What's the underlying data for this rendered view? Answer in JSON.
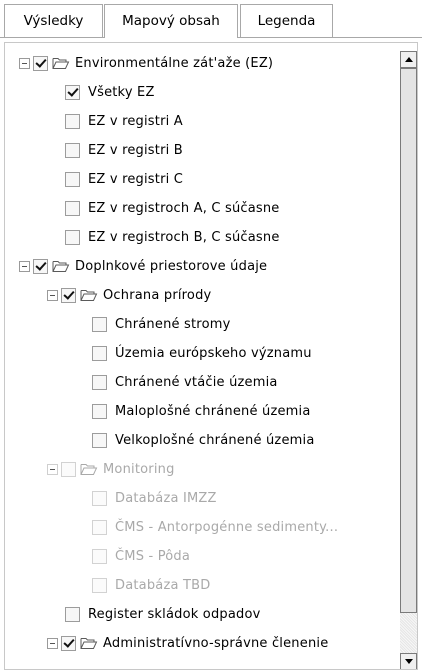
{
  "tabs": [
    {
      "label": "Výsledky",
      "active": false
    },
    {
      "label": "Mapový obsah",
      "active": true
    },
    {
      "label": "Legenda",
      "active": false
    }
  ],
  "tree": {
    "items": [
      {
        "label": "Environmentálne zát'aže (EZ)",
        "checked": true,
        "folder": true,
        "expander": true,
        "dim": false
      },
      {
        "label": "Všetky EZ",
        "checked": true,
        "folder": false,
        "expander": false,
        "dim": false
      },
      {
        "label": "EZ v registri A",
        "checked": false,
        "folder": false,
        "expander": false,
        "dim": false
      },
      {
        "label": "EZ v registri B",
        "checked": false,
        "folder": false,
        "expander": false,
        "dim": false
      },
      {
        "label": "EZ v registri C",
        "checked": false,
        "folder": false,
        "expander": false,
        "dim": false
      },
      {
        "label": "EZ v registroch A, C súčasne",
        "checked": false,
        "folder": false,
        "expander": false,
        "dim": false
      },
      {
        "label": "EZ v registroch B, C súčasne",
        "checked": false,
        "folder": false,
        "expander": false,
        "dim": false
      },
      {
        "label": "Doplnkové priestorove údaje",
        "checked": true,
        "folder": true,
        "expander": true,
        "dim": false
      },
      {
        "label": "Ochrana prírody",
        "checked": true,
        "folder": true,
        "expander": true,
        "dim": false
      },
      {
        "label": "Chránené stromy",
        "checked": false,
        "folder": false,
        "expander": false,
        "dim": false
      },
      {
        "label": "Územia európskeho významu",
        "checked": false,
        "folder": false,
        "expander": false,
        "dim": false
      },
      {
        "label": "Chránené vtáčie územia",
        "checked": false,
        "folder": false,
        "expander": false,
        "dim": false
      },
      {
        "label": "Maloplošné chránené územia",
        "checked": false,
        "folder": false,
        "expander": false,
        "dim": false
      },
      {
        "label": "Velkoplošné chránené územia",
        "checked": false,
        "folder": false,
        "expander": false,
        "dim": false
      },
      {
        "label": "Monitoring",
        "checked": false,
        "folder": true,
        "expander": true,
        "dim": true
      },
      {
        "label": "Databáza IMZZ",
        "checked": false,
        "folder": false,
        "expander": false,
        "dim": true
      },
      {
        "label": "ČMS - Antorpogénne sedimenty...",
        "checked": false,
        "folder": false,
        "expander": false,
        "dim": true
      },
      {
        "label": "ČMS - Pôda",
        "checked": false,
        "folder": false,
        "expander": false,
        "dim": true
      },
      {
        "label": "Databáza TBD",
        "checked": false,
        "folder": false,
        "expander": false,
        "dim": true
      },
      {
        "label": "Register skládok odpadov",
        "checked": false,
        "folder": false,
        "expander": false,
        "dim": false
      },
      {
        "label": "Administratívno-správne členenie",
        "checked": true,
        "folder": true,
        "expander": true,
        "dim": false
      }
    ]
  },
  "colors": {
    "folder_stroke": "#5a5a5a",
    "border": "#a8a8a8"
  }
}
